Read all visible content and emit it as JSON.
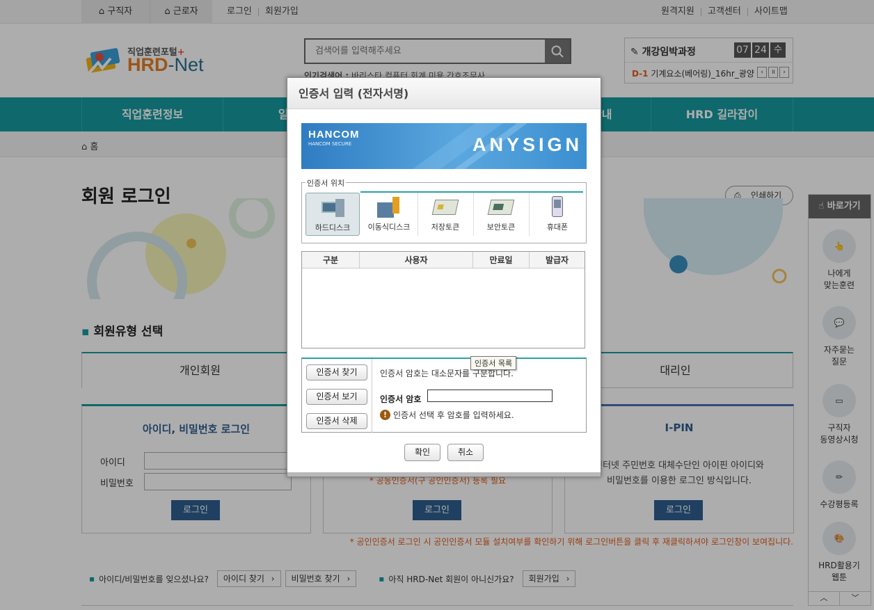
{
  "topbar": {
    "tabs": [
      "구직자",
      "근로자"
    ],
    "links_left": [
      "로그인",
      "회원가입"
    ],
    "links_right": [
      "원격지원",
      "고객센터",
      "사이트맵"
    ]
  },
  "header": {
    "logo_sub": "직업훈련포털",
    "logo_plus": "+",
    "logo_hrd": "HRD",
    "logo_net": "-Net",
    "search_placeholder": "검색어를 입력해주세요",
    "popular_label": "인기검색어 :",
    "popular_terms": "바리스타 컴퓨터 회계 미용 간호조무사",
    "upcoming_title": "개강임박과정",
    "date_month": "07",
    "date_day": "24",
    "date_weekday": "수",
    "dday": "D-1",
    "upcoming_course": "기계요소(베어링)_16hr_광양"
  },
  "nav": {
    "items": [
      "직업훈련정보",
      "일자리",
      "",
      "안내",
      "HRD 길라잡이"
    ]
  },
  "breadcrumb": {
    "home": "홈"
  },
  "page": {
    "title": "회원 로그인",
    "print_label": "인쇄하기",
    "section_title": "회원유형 선택",
    "tab_personal": "개인회원",
    "tab_agent": "대리인",
    "box1_title": "아이디, 비밀번호 로그인",
    "id_label": "아이디",
    "pw_label": "비밀번호",
    "login_label": "로그인",
    "box2_note": "* 공동인증서(구 공인인증서) 등록 필요",
    "box3_title": "I-PIN",
    "box3_desc1": "인터넷 주민번호 대체수단인 아이핀 아이디와",
    "box3_desc2": "비밀번호를 이용한 로그인 방식입니다.",
    "notice": "* 공인인증서 로그인 시 공인인증서 모듈 설치여부를 확인하기 위해 로그인버튼을 클릭 후 재클릭하셔야 로그인창이 보여집니다.",
    "forgot_text": "아이디/비밀번호를 잊으셨나요?",
    "find_id": "아이디 찾기",
    "find_pw": "비밀번호 찾기",
    "not_member": "아직 HRD-Net 회원이 아니신가요?",
    "join": "회원가입"
  },
  "sidebar": {
    "title": "바로가기",
    "items": [
      "나에게\n맞는훈련",
      "자주묻는\n질문",
      "구직자\n동영상시청",
      "수강평등록",
      "HRD활용기\n웹툰"
    ]
  },
  "dialog": {
    "title": "인증서 입력 (전자서명)",
    "banner_brand": "HANCOM",
    "banner_brand_sub": "HANCOM SECURE",
    "banner_product": "ANYSIGN",
    "location_legend": "인증서 위치",
    "locations": [
      "하드디스크",
      "이동식디스크",
      "저장토큰",
      "보안토큰",
      "휴대폰"
    ],
    "table_headers": [
      "구분",
      "사용자",
      "만료일",
      "발급자"
    ],
    "tooltip": "인증서 목록",
    "btn_find": "인증서 찾기",
    "btn_view": "인증서 보기",
    "btn_delete": "인증서 삭제",
    "case_note": "인증서 암호는 대소문자를 구분합니다.",
    "password_label": "인증서 암호",
    "password_value": "",
    "hint": "인증서 선택 후 암호를 입력하세요.",
    "ok": "확인",
    "cancel": "취소"
  },
  "colors": {
    "teal": "#159aa0",
    "navy": "#2f5f8f",
    "orange": "#e25a1c",
    "anysign_blue": "#3b8fd0"
  }
}
